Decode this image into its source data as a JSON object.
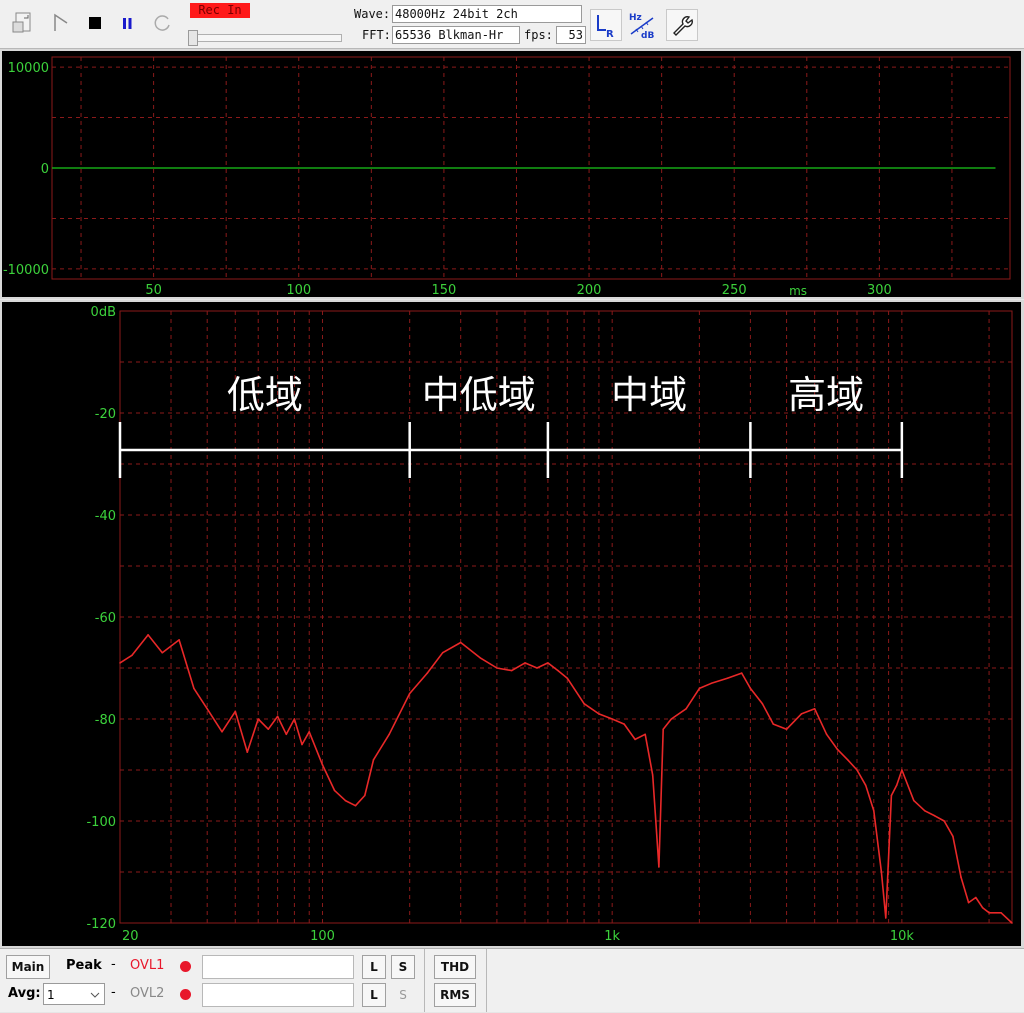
{
  "toolbar": {
    "rec_label": "Rec In",
    "wave_label": "Wave:",
    "wave_value": "48000Hz 24bit 2ch",
    "fft_label": "FFT:",
    "fft_value": "65536 Blkman-Hr",
    "fps_label": "fps:",
    "fps_value": "53",
    "lr_icon_text": "L R",
    "hz_icon_text": "Hz",
    "db_icon_text": "dB",
    "icons": [
      "export-icon",
      "flag-icon",
      "stop-icon",
      "pause-icon",
      "reload-icon",
      "lr-channel-icon",
      "hz-db-scale-icon",
      "wrench-icon"
    ]
  },
  "wave_chart": {
    "y_ticks": [
      "10000",
      "0",
      "-10000"
    ],
    "x_ticks": [
      "50",
      "100",
      "150",
      "200",
      "250",
      "300"
    ],
    "x_unit": "ms",
    "trace_color": "#19c819",
    "grid_color": "#8b1a1a"
  },
  "spectrum_chart": {
    "y_ticks": [
      "0dB",
      "-20",
      "-40",
      "-60",
      "-80",
      "-100",
      "-120"
    ],
    "x_ticks": [
      "20",
      "100",
      "1k",
      "10k"
    ],
    "band_labels": [
      "低域",
      "中低域",
      "中域",
      "高域"
    ],
    "band_edges_hz": [
      20,
      200,
      600,
      3000,
      10000
    ],
    "trace_color": "#e82828",
    "axis_text_color": "#3cd23c"
  },
  "chart_data": [
    {
      "type": "line",
      "x": [
        15,
        340
      ],
      "y": [
        0,
        0
      ],
      "xlabel": "ms",
      "ylabel": "",
      "xlim": [
        15,
        345
      ],
      "ylim": [
        -11000,
        11000
      ],
      "grid": true
    },
    {
      "type": "line",
      "series": [
        {
          "x": [
            20,
            22,
            25,
            28,
            32,
            36,
            40,
            45,
            50,
            55,
            60,
            65,
            70,
            75,
            80,
            85,
            90,
            100,
            110,
            120,
            130,
            140,
            150,
            170,
            200,
            230,
            260,
            300,
            350,
            400,
            450,
            500,
            550,
            600,
            650,
            700,
            800,
            900,
            1000,
            1100,
            1200,
            1300,
            1380,
            1450,
            1500,
            1600,
            1800,
            2000,
            2200,
            2500,
            2800,
            3000,
            3300,
            3600,
            4000,
            4500,
            5000,
            5500,
            6000,
            6500,
            7000,
            7500,
            8000,
            8500,
            8800,
            9200,
            9600,
            10000,
            11000,
            12000,
            13000,
            14000,
            15000,
            16000,
            17000,
            18000,
            19000,
            20000,
            22000,
            24000
          ],
          "y": [
            -69,
            -67.5,
            -63.5,
            -67,
            -64.5,
            -74,
            -78,
            -82.5,
            -78.5,
            -86.5,
            -80,
            -82,
            -79.5,
            -83,
            -80,
            -85,
            -82.5,
            -89,
            -94,
            -96,
            -97,
            -95,
            -88,
            -83,
            -75,
            -71,
            -67,
            -65,
            -68,
            -70,
            -70.5,
            -69,
            -70,
            -69,
            -70.5,
            -72,
            -77,
            -79,
            -80,
            -81,
            -84,
            -83,
            -91,
            -109,
            -82,
            -80,
            -78,
            -74,
            -73,
            -72,
            -71,
            -74,
            -77,
            -81,
            -82,
            -79,
            -78,
            -83,
            -86,
            -88,
            -90,
            -93,
            -98,
            -110,
            -119,
            -95,
            -93,
            -90,
            -96,
            -98,
            -99,
            -100,
            -103,
            -111,
            -116,
            -115,
            -117,
            -118,
            -118,
            -120
          ]
        }
      ],
      "xlabel": "",
      "ylabel": "",
      "xlim": [
        20,
        24000
      ],
      "ylim": [
        -120,
        0
      ],
      "log_x": true,
      "grid": true
    }
  ],
  "bottom_bar": {
    "main_label": "Main",
    "peak_label": "Peak",
    "dash1": "-",
    "ovl1_label": "OVL1",
    "l1_label": "L",
    "s1_label": "S",
    "thd_label": "THD",
    "avg_label": "Avg:",
    "avg_value": "1",
    "dash2": "-",
    "ovl2_label": "OVL2",
    "l2_label": "L",
    "s2_label": "S",
    "rms_label": "RMS"
  }
}
